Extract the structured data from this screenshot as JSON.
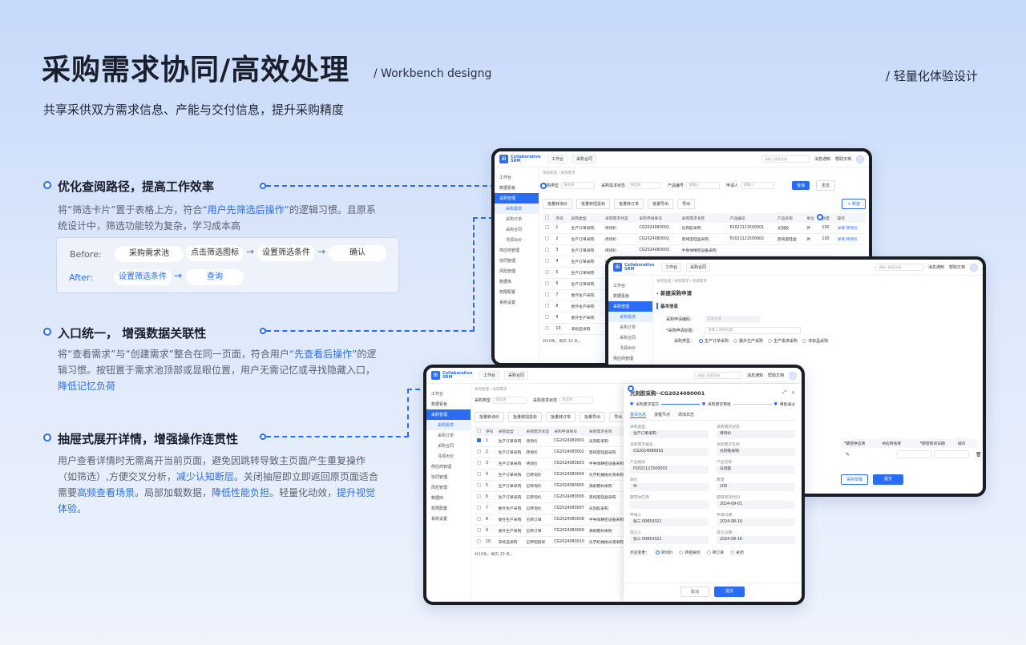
{
  "header": {
    "title": "采购需求协同/高效处理",
    "subtitle": "/ Workbench designg",
    "right_label": "/ 轻量化体验设计",
    "tagline": "共享采供双方需求信息、产能与交付信息，提升采购精度"
  },
  "sections": [
    {
      "title": "优化查阅路径，提高工作效率",
      "body_parts": [
        "将“筛选卡片”置于表格上方，符合",
        {
          "hl": "“用户先筛选后操作”"
        },
        "的逻辑习惯。且原系统设计中，筛选功能较为复杂，学习成本高"
      ]
    },
    {
      "title": "入口统一， 增强数据关联性",
      "body_parts": [
        "将“查看需求”与“创建需求”整合在同一页面，符合用户",
        {
          "hl": "“先查看后操作”"
        },
        "的逻辑习惯。按钮置于需求池顶部或显眼位置，用户无需记忆或寻找隐藏入口，",
        {
          "hl": "降低记忆负荷"
        }
      ]
    },
    {
      "title": "抽屉式展开详情，增强操作连贯性",
      "body_parts": [
        "用户查看详情时无需离开当前页面，避免因跳转导致主页面产生重复操作（如筛选）,方便交叉分析，",
        {
          "hl": "减少认知断层"
        },
        "。关闭抽屉即立即返回原页面适合需要",
        {
          "hl": "高频查看场景"
        },
        "。局部加载数据，",
        {
          "hl": "降低性能负担"
        },
        "。轻量化动效，",
        {
          "hl": "提升视觉体验"
        },
        "。"
      ]
    }
  ],
  "flow": {
    "before_label": "Before:",
    "before_steps": [
      "采购需求池",
      "点击筛选图标",
      "设置筛选条件",
      "确认"
    ],
    "after_label": "After:",
    "after_steps": [
      "设置筛选条件",
      "查询"
    ]
  },
  "app": {
    "logo": [
      "Collaborative",
      "SRM"
    ],
    "tabs": [
      "工作台",
      "采购合同"
    ],
    "search_placeholder": "请输入搜索关键",
    "notify": "消息通知",
    "help": "帮助文档",
    "nav": [
      "工作台",
      "数据看板",
      "采购管理",
      "供应商管理",
      "协同管理",
      "风险管理",
      "数据库",
      "权限配置",
      "系统设置"
    ],
    "subnav": [
      "采购需求",
      "采购订单",
      "采购合同",
      "寻源出价"
    ],
    "crumb": "采购管理 / 采购需求",
    "filters": [
      {
        "label": "采购类型",
        "ph": "请选择"
      },
      {
        "label": "采购需求状态",
        "ph": "请选择"
      },
      {
        "label": "产品编号",
        "ph": "请输入"
      },
      {
        "label": "申请人",
        "ph": "请输入"
      }
    ],
    "query": "查询",
    "reset": "重置",
    "create": "+ 新建",
    "actions": [
      "批量转询价",
      "批量转招投标",
      "批量转订单",
      "批量导出",
      "导出"
    ],
    "columns": [
      "序号",
      "采购类型",
      "采购需求状态",
      "采购申请单号",
      "采购需求名称",
      "产品编号",
      "产品名称",
      "单位",
      "数量",
      "操作"
    ],
    "rows": [
      [
        "1",
        "生产订单采购",
        "待询价",
        "CG2024080001",
        "光刻胶采购",
        "P2021121500001",
        "光刻胶",
        "件",
        "100"
      ],
      [
        "2",
        "生产订单采购",
        "待询价",
        "CG2024080002",
        "高纯度硅晶采购",
        "P2021121500002",
        "高纯度硅晶",
        "件",
        "100"
      ],
      [
        "3",
        "生产订单采购",
        "待询价",
        "CG2024080003",
        "半导体精密设备采购",
        "",
        "",
        "",
        ""
      ],
      [
        "4",
        "生产订单采购",
        "已转询价",
        "CG2024080004",
        "化学机械抛光液采购",
        "",
        "",
        "",
        ""
      ],
      [
        "5",
        "生产订单采购",
        "已转询价",
        "CG2024080005",
        "溅射靶材采购",
        "",
        "",
        "",
        ""
      ],
      [
        "6",
        "生产订单采购",
        "已转询价",
        "CG2024080006",
        "高纯度硅晶采购",
        "",
        "",
        "",
        ""
      ],
      [
        "7",
        "委外生产采购",
        "已转询价",
        "CG2024080007",
        "光刻胶采购",
        "",
        "",
        "",
        ""
      ],
      [
        "8",
        "委外生产采购",
        "已转订单",
        "CG2024080008",
        "半导体精密设备采购",
        "",
        "",
        "",
        ""
      ],
      [
        "9",
        "委外生产采购",
        "已转订单",
        "CG2024080009",
        "溅射靶材采购",
        "",
        "",
        "",
        ""
      ],
      [
        "10",
        "非标品采购",
        "已转招投标",
        "CG2024080010",
        "化学机械抛光液采购",
        "",
        "",
        "",
        ""
      ]
    ],
    "row_ops": [
      "详情",
      "转询价"
    ],
    "pager": "共10条，每页",
    "pager_size": "10",
    "pager_unit": "条。",
    "new_form": {
      "crumb": "采购管理 / 采购需求 / 新建需求",
      "title": "新建采购申请",
      "section": "基本信息",
      "f1": "采购申请编码：",
      "f1v": "自动生成",
      "f2": "*采购申请标题：",
      "f2v": "请输入采购标题",
      "f3": "采购类型：",
      "types": [
        "生产订单采购",
        "委外生产采购",
        "生产需求采购",
        "非标品采购"
      ],
      "cols": [
        "*期望供应商",
        "供应商名称",
        "*期望到货日期",
        "操作"
      ],
      "save": "保存草稿",
      "submit": "提交"
    },
    "drawer": {
      "title": "光刻胶采购--CG2024080001",
      "steps": [
        "采购需求提交",
        "采购需求审批",
        "审批通过"
      ],
      "tabs": [
        "基本信息",
        "流程节点",
        "添加日志"
      ],
      "fields": [
        [
          "采购类型",
          "生产订单采购"
        ],
        [
          "采购需求状态",
          "待询价"
        ],
        [
          "采购需求编号",
          "CG2024080001"
        ],
        [
          "采购需求名称",
          "光刻胶采购"
        ],
        [
          "产品编号",
          "P2021121500001"
        ],
        [
          "产品名称",
          "光刻胶"
        ],
        [
          "单位",
          "件"
        ],
        [
          "数量",
          "100"
        ],
        [
          "期望供应商",
          ""
        ],
        [
          "期望到货时间",
          "2024-09-01"
        ],
        [
          "申请人",
          "张三 00654321"
        ],
        [
          "申请日期",
          "2024-08-16"
        ],
        [
          "提交人",
          "张三 00654321"
        ],
        [
          "提交日期",
          "2024-08-16"
        ]
      ],
      "status_label": "状态变更：",
      "status_opts": [
        "转询价",
        "转招投标",
        "转订单",
        "关闭"
      ],
      "cancel": "取消",
      "ok": "提交"
    }
  }
}
